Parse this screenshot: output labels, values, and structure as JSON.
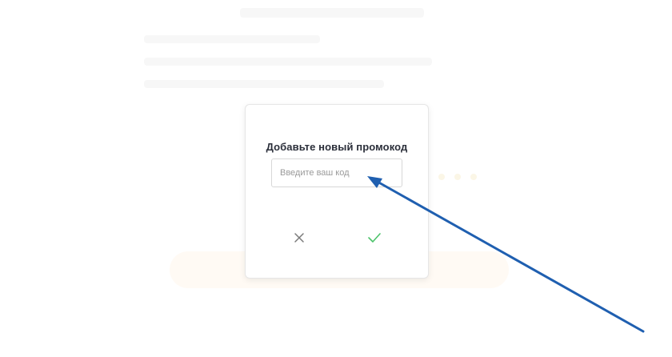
{
  "modal": {
    "title": "Добавьте новый промокод",
    "input_placeholder": "Введите ваш код",
    "input_value": "",
    "cancel_icon": "close-icon",
    "confirm_icon": "check-icon",
    "confirm_color": "#4cc36b",
    "cancel_color": "#7a7a7a"
  },
  "annotation": {
    "arrow_color": "#1f5fb0"
  }
}
